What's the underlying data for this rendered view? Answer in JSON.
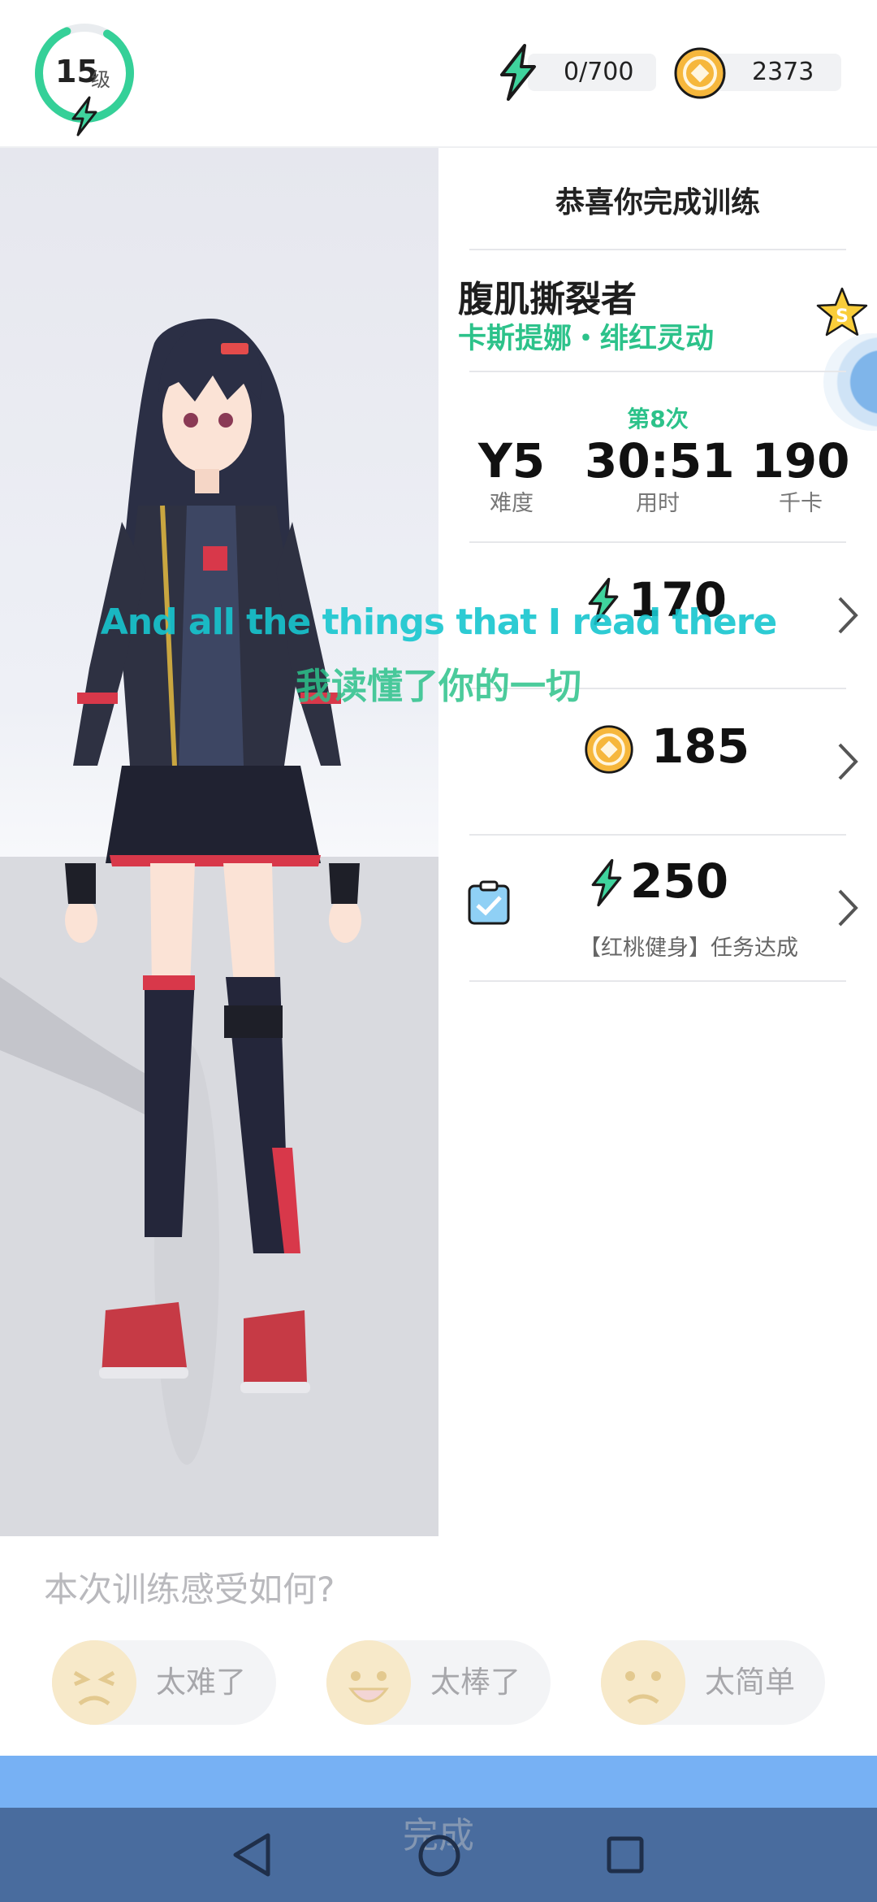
{
  "header": {
    "level": "15",
    "level_unit": "级",
    "energy": "0/700",
    "coins": "2373"
  },
  "summary": {
    "title": "恭喜你完成训练",
    "course_name": "腹肌撕裂者",
    "coach": "卡斯提娜・绯红灵动",
    "badge": "S",
    "times": "第8次",
    "stats": [
      {
        "value": "Y5",
        "label": "难度"
      },
      {
        "value": "30:51",
        "label": "用时"
      },
      {
        "value": "190",
        "label": "千卡"
      }
    ],
    "rewards": [
      {
        "icon": "energy-bolt-icon",
        "value": "170"
      },
      {
        "icon": "coin-icon",
        "value": "185"
      },
      {
        "icon": "energy-bolt-icon",
        "value": "250",
        "note": "【红桃健身】任务达成"
      }
    ]
  },
  "subtitles": {
    "en": "And all the things that I read there",
    "zh": "我读懂了你的一切"
  },
  "feedback": {
    "question": "本次训练感受如何?",
    "options": [
      "太难了",
      "太棒了",
      "太简单"
    ]
  },
  "bottom": {
    "done": "完成"
  },
  "colors": {
    "accent_green": "#2cc28a",
    "coin_yellow": "#f6b73c",
    "done_blue": "#77b1f4",
    "nav_bar": "#496c9e"
  }
}
